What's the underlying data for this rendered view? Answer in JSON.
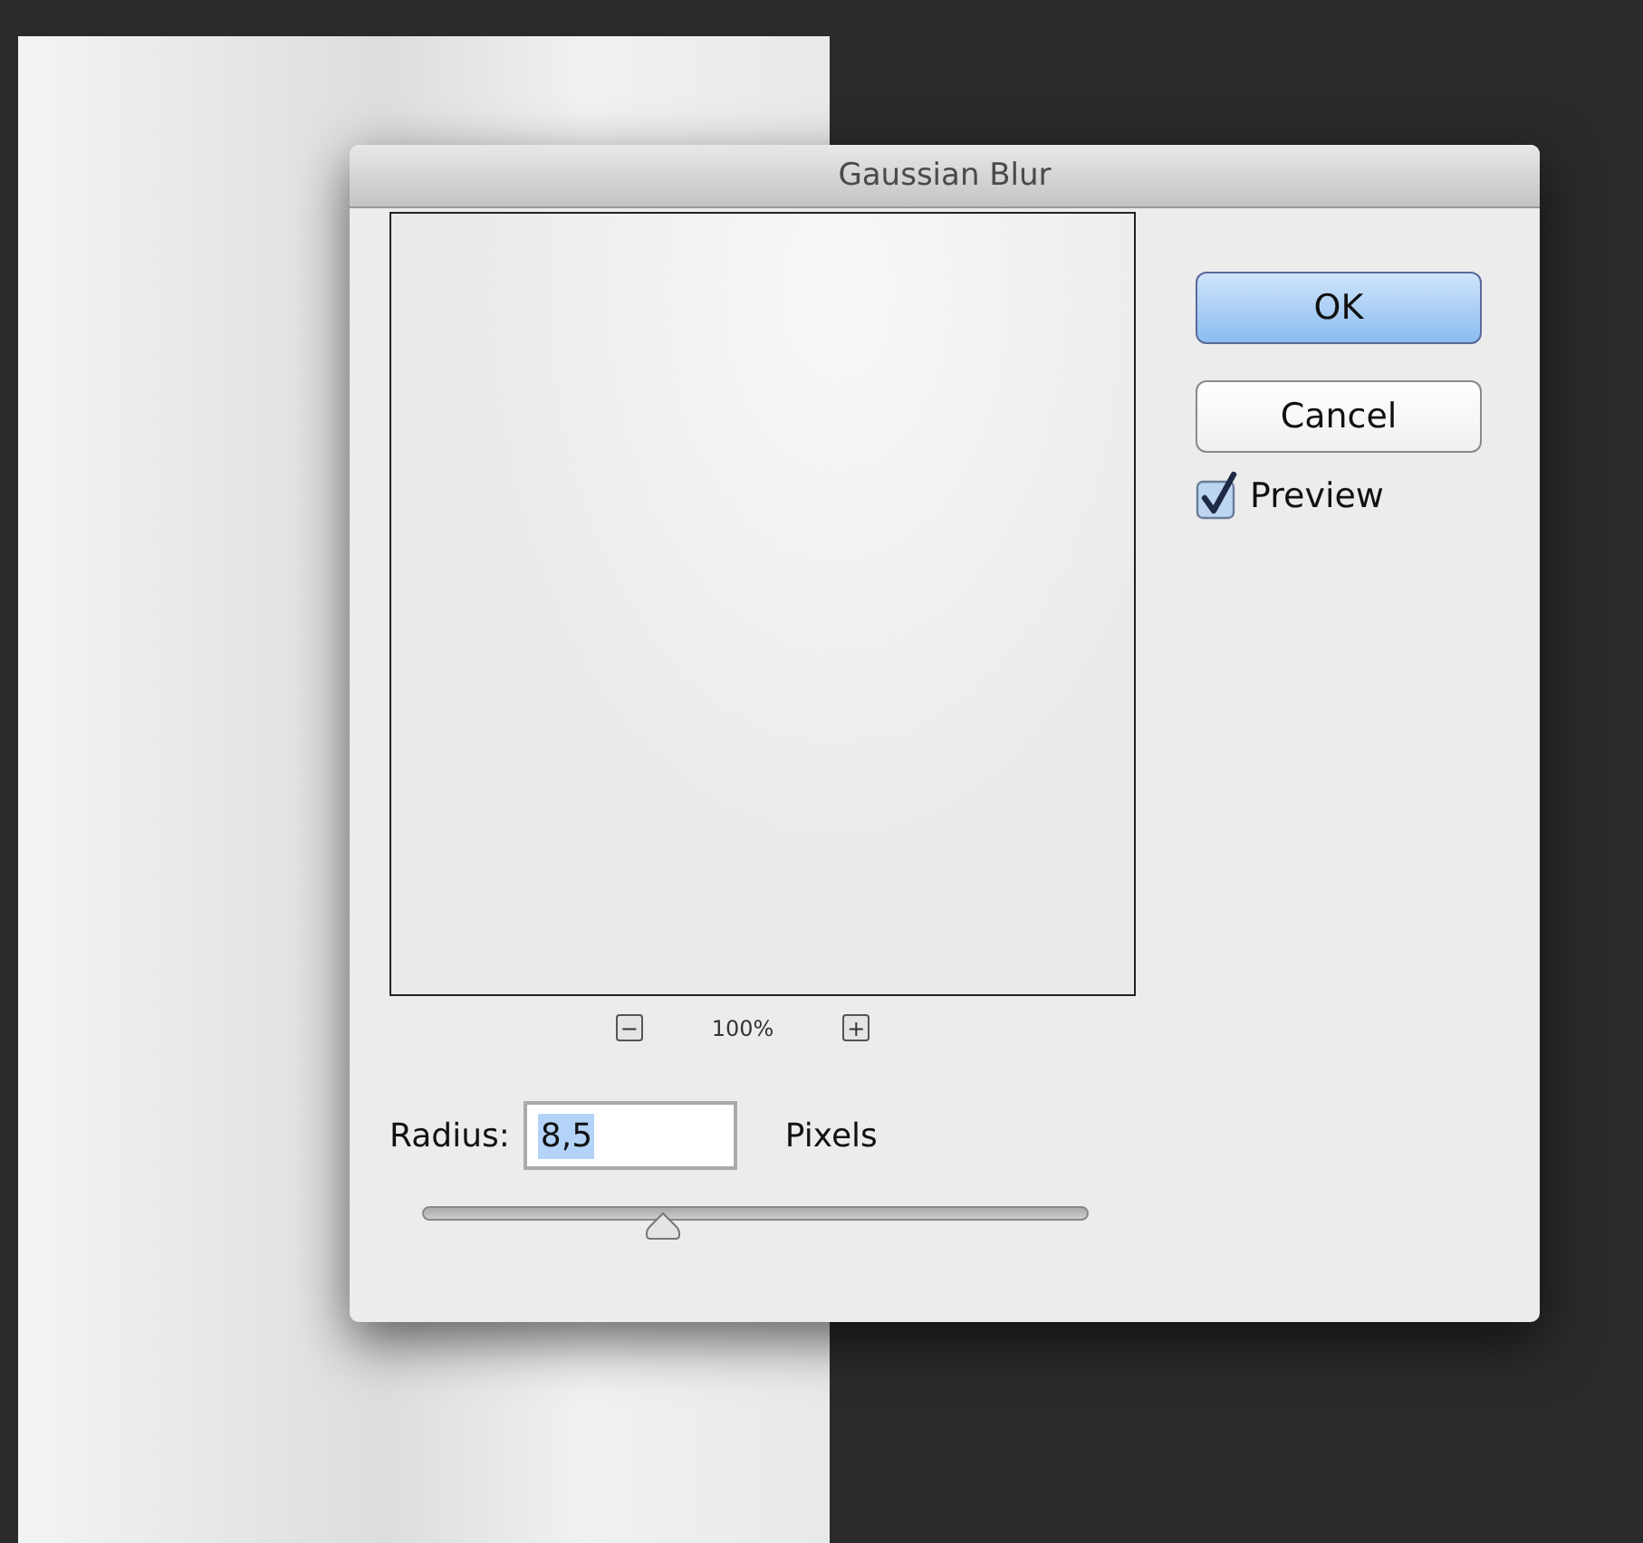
{
  "dialog": {
    "title": "Gaussian Blur",
    "zoom": {
      "out_label": "−",
      "level": "100%",
      "in_label": "+"
    },
    "radius": {
      "label": "Radius:",
      "value": "8,5",
      "unit": "Pixels",
      "value_selected": true
    },
    "slider": {
      "level": 0.36
    },
    "buttons": [
      {
        "label": "OK",
        "default": true
      },
      {
        "label": "Cancel",
        "default": false
      }
    ],
    "preview": {
      "label": "Preview",
      "checked": true
    }
  }
}
